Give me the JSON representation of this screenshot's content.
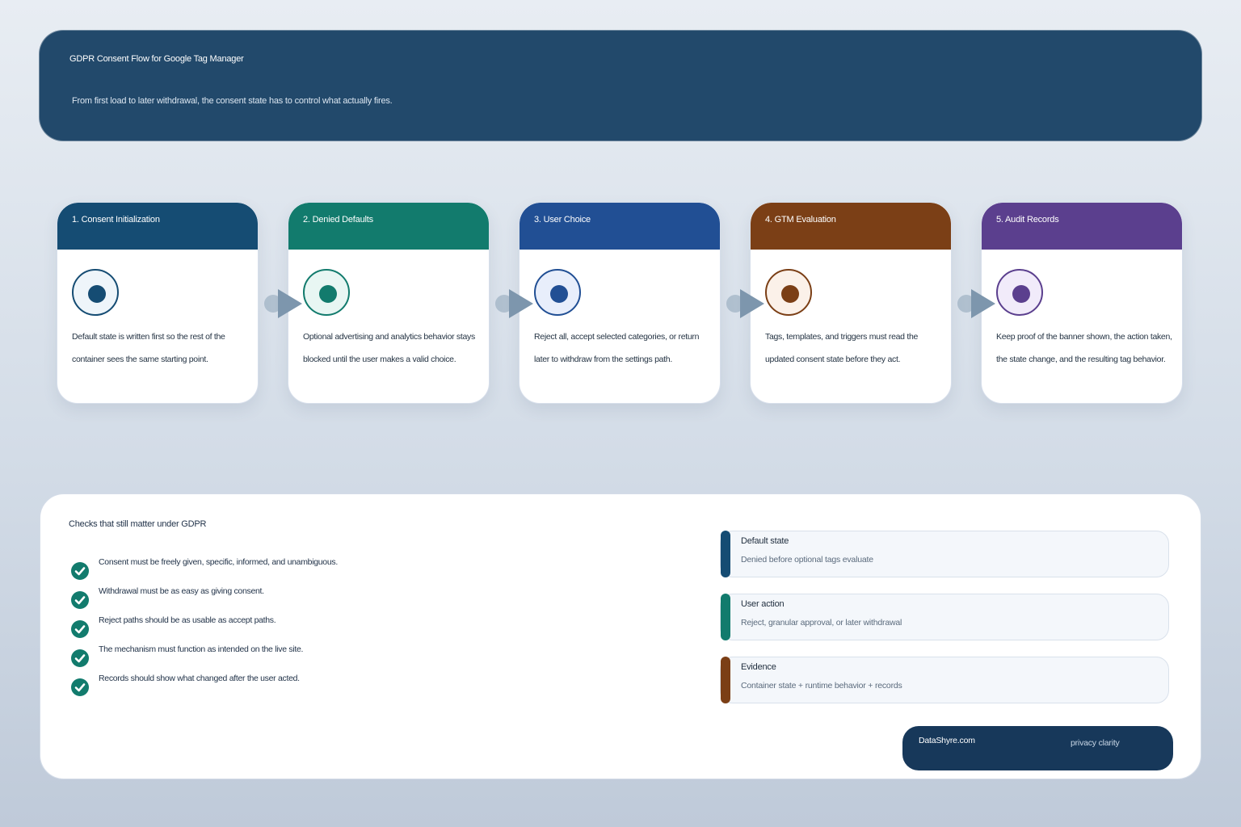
{
  "header": {
    "title": "GDPR Consent Flow for Google Tag Manager",
    "subtitle": "From first load to later withdrawal, the consent state has to control what actually fires."
  },
  "steps": [
    {
      "title": "1. Consent Initialization",
      "text": "Default state is written first so the rest of the container sees the same starting point.",
      "color": "#154c73",
      "icon_bg": "#eef5fa"
    },
    {
      "title": "2. Denied Defaults",
      "text": "Optional advertising and analytics behavior stays blocked until the user makes a valid choice.",
      "color": "#127b6d",
      "icon_bg": "#e8f6f3"
    },
    {
      "title": "3. User Choice",
      "text": "Reject all, accept selected categories, or return later to withdraw from the settings path.",
      "color": "#214f94",
      "icon_bg": "#e8eefb"
    },
    {
      "title": "4. GTM Evaluation",
      "text": "Tags, templates, and triggers must read the updated consent state before they act.",
      "color": "#7b3f16",
      "icon_bg": "#fbf1e9"
    },
    {
      "title": "5. Audit Records",
      "text": "Keep proof of the banner shown, the action taken, the state change, and the resulting tag behavior.",
      "color": "#5b3f8e",
      "icon_bg": "#f1ebfa"
    }
  ],
  "checks": {
    "title": "Checks that still matter under GDPR",
    "items": [
      "Consent must be freely given, specific, informed, and unambiguous.",
      "Withdrawal must be as easy as giving consent.",
      "Reject paths should be as usable as accept paths.",
      "The mechanism must function as intended on the live site.",
      "Records should show what changed after the user acted."
    ],
    "check_color": "#127b6d"
  },
  "info": [
    {
      "label": "Default state",
      "value": "Denied before optional tags evaluate",
      "color": "#154c73"
    },
    {
      "label": "User action",
      "value": "Reject, granular approval, or later withdrawal",
      "color": "#127b6d"
    },
    {
      "label": "Evidence",
      "value": "Container state + runtime behavior + records",
      "color": "#7b3f16"
    }
  ],
  "brand": {
    "name": "DataShyre.com",
    "tagline": "privacy clarity"
  },
  "connector_color": "#7d96ad"
}
